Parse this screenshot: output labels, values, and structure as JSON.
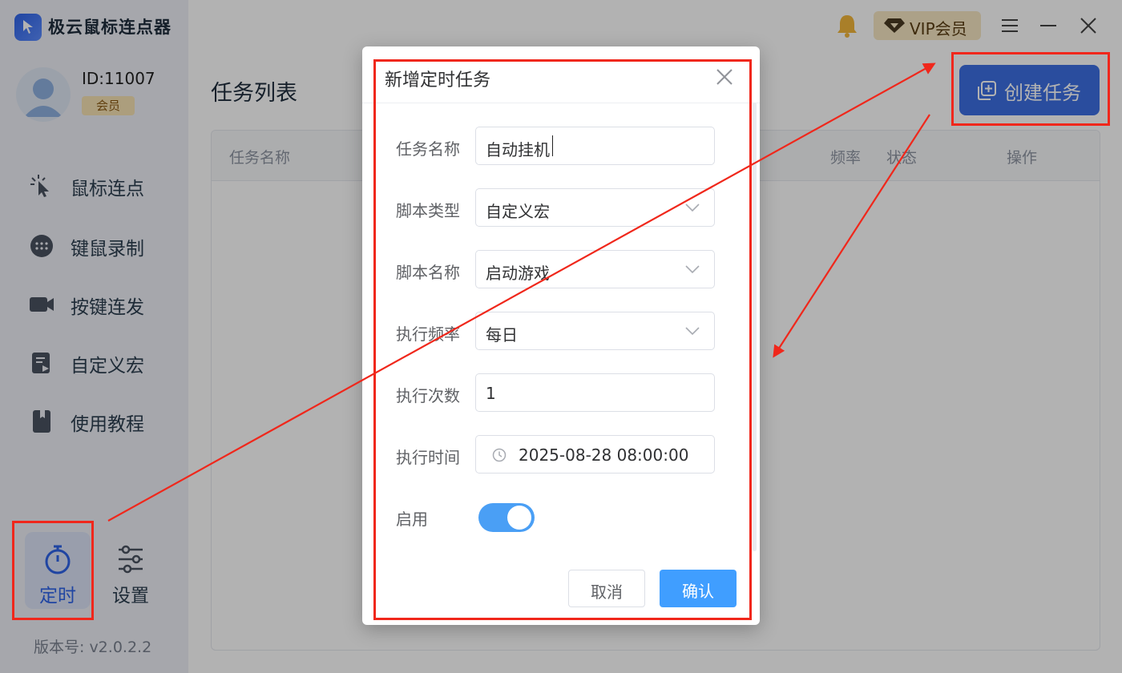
{
  "app": {
    "title": "极云鼠标连点器"
  },
  "user": {
    "id": "ID:11007",
    "badge": "会员"
  },
  "sidebar": {
    "items": [
      {
        "label": "鼠标连点",
        "icon": "click-cursor-icon"
      },
      {
        "label": "键鼠录制",
        "icon": "keyboard-icon"
      },
      {
        "label": "按键连发",
        "icon": "camera-icon"
      },
      {
        "label": "自定义宏",
        "icon": "macro-icon"
      },
      {
        "label": "使用教程",
        "icon": "book-icon"
      }
    ],
    "bottom": {
      "timer_label": "定时",
      "settings_label": "设置"
    },
    "version": "版本号: v2.0.2.2"
  },
  "topbar": {
    "vip_label": "VIP会员"
  },
  "main": {
    "title": "任务列表",
    "create_label": "创建任务",
    "columns": [
      "任务名称",
      "频率",
      "状态",
      "操作"
    ]
  },
  "dialog": {
    "title": "新增定时任务",
    "fields": {
      "task_name": {
        "label": "任务名称",
        "value": "自动挂机"
      },
      "script_type": {
        "label": "脚本类型",
        "value": "自定义宏"
      },
      "script_name": {
        "label": "脚本名称",
        "value": "启动游戏"
      },
      "frequency": {
        "label": "执行频率",
        "value": "每日"
      },
      "count": {
        "label": "执行次数",
        "value": "1"
      },
      "time": {
        "label": "执行时间",
        "value": "2025-08-28 08:00:00"
      },
      "enabled": {
        "label": "启用",
        "on": true
      }
    },
    "cancel_label": "取消",
    "confirm_label": "确认"
  },
  "colors": {
    "accent": "#3d6fe3",
    "primary_button": "#409eff",
    "annotation": "#f0271b",
    "switch_on": "#4a9ff5"
  }
}
